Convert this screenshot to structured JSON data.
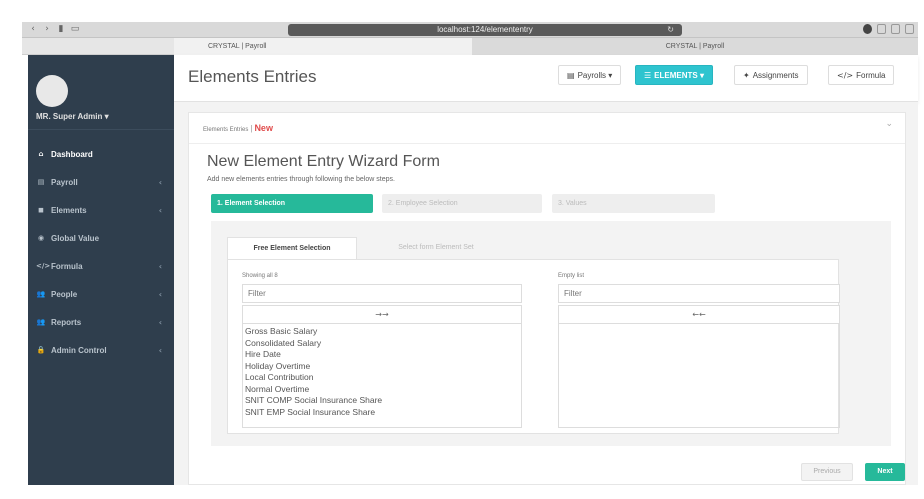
{
  "browser": {
    "url": "localhost:124/elemententry",
    "tabs": [
      {
        "label": "CRYSTAL | Payroll"
      },
      {
        "label": "CRYSTAL | Payroll"
      }
    ]
  },
  "sidebar": {
    "username": "MR. Super Admin ▾",
    "items": [
      {
        "label": "Dashboard",
        "icon": "home-icon",
        "glyph": "⌂",
        "has_children": false
      },
      {
        "label": "Payroll",
        "icon": "payroll-icon",
        "glyph": "▤",
        "has_children": true
      },
      {
        "label": "Elements",
        "icon": "elements-icon",
        "glyph": "◼",
        "has_children": true
      },
      {
        "label": "Global Value",
        "icon": "globe-icon",
        "glyph": "◉",
        "has_children": false
      },
      {
        "label": "Formula",
        "icon": "code-icon",
        "glyph": "</>",
        "has_children": true
      },
      {
        "label": "People",
        "icon": "people-icon",
        "glyph": "👥",
        "has_children": true
      },
      {
        "label": "Reports",
        "icon": "reports-icon",
        "glyph": "👥",
        "has_children": true
      },
      {
        "label": "Admin Control",
        "icon": "lock-icon",
        "glyph": "🔒",
        "has_children": true
      }
    ]
  },
  "header": {
    "title": "Elements Entries",
    "buttons": {
      "payrolls": "Payrolls ▾",
      "elements": "ELEMENTS ▾",
      "assignments": "Assignments",
      "formula": "Formula"
    }
  },
  "breadcrumb": {
    "parent": "Elements Entries",
    "current": "New"
  },
  "wizard": {
    "title": "New Element Entry Wizard Form",
    "subtitle": "Add new elements entries through following the below steps.",
    "steps": [
      {
        "label": "1. Element Selection",
        "active": true
      },
      {
        "label": "2. Employee Selection",
        "active": false
      },
      {
        "label": "3. Values",
        "active": false
      }
    ],
    "tabs": {
      "free": "Free Element Selection",
      "set": "Select form Element Set"
    },
    "left_list": {
      "info": "Showing all 8",
      "filter_placeholder": "Filter",
      "move_label": "→→",
      "items": [
        "Gross Basic Salary",
        "Consolidated Salary",
        "Hire Date",
        "Holiday Overtime",
        "Local Contribution",
        "Normal Overtime",
        "SNIT COMP Social Insurance Share",
        "SNIT EMP Social Insurance Share"
      ]
    },
    "right_list": {
      "info": "Empty list",
      "filter_placeholder": "Filter",
      "move_label": "←←",
      "items": []
    },
    "buttons": {
      "previous": "Previous",
      "next": "Next"
    }
  },
  "colors": {
    "sidebar_bg": "#2f3e4d",
    "primary_teal": "#26b99a",
    "elements_button": "#2ec4cf",
    "breadcrumb_new": "#e04c4c"
  }
}
